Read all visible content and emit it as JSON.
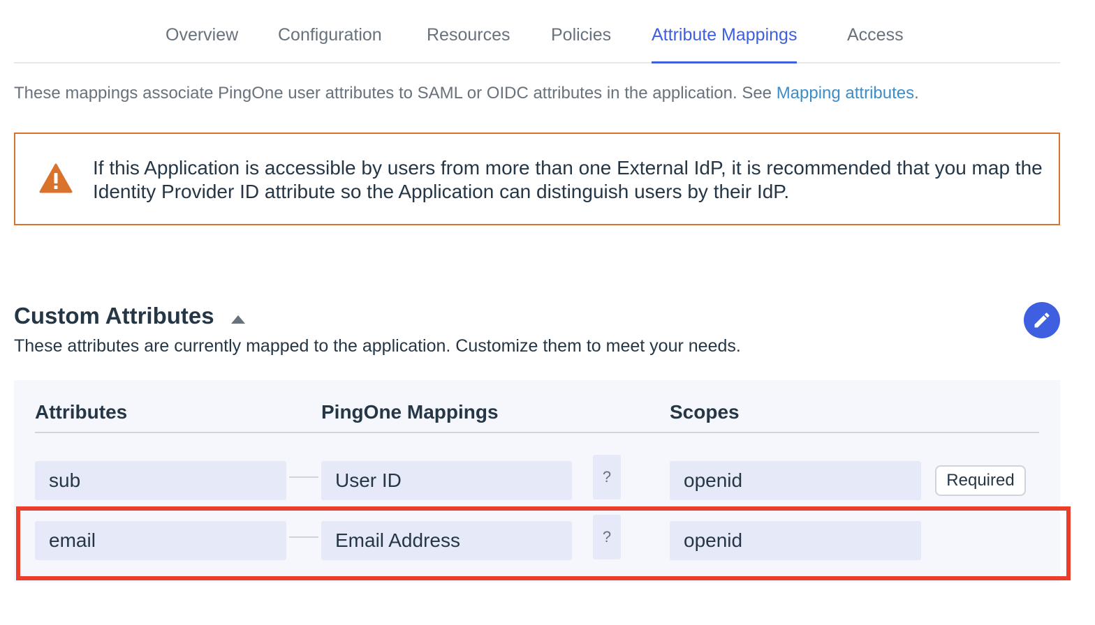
{
  "tabs": [
    {
      "label": "Overview",
      "active": false
    },
    {
      "label": "Configuration",
      "active": false
    },
    {
      "label": "Resources",
      "active": false
    },
    {
      "label": "Policies",
      "active": false
    },
    {
      "label": "Attribute Mappings",
      "active": true
    },
    {
      "label": "Access",
      "active": false
    }
  ],
  "intro": {
    "text": "These mappings associate PingOne user attributes to SAML or OIDC attributes in the application. See ",
    "link": "Mapping attributes",
    "suffix": "."
  },
  "warning": {
    "icon": "warning-triangle-icon",
    "text": "If this Application is accessible by users from more than one External IdP, it is recommended that you map the Identity Provider ID attribute so the Application can distinguish users by their IdP."
  },
  "section": {
    "title": "Custom Attributes",
    "description": "These attributes are currently mapped to the application. Customize them to meet your needs.",
    "edit_icon": "pencil-icon"
  },
  "table": {
    "headers": {
      "attributes": "Attributes",
      "mappings": "PingOne Mappings",
      "scopes": "Scopes"
    },
    "rows": [
      {
        "attribute": "sub",
        "mapping": "User ID",
        "help": "?",
        "scope": "openid",
        "badge": "Required"
      },
      {
        "attribute": "email",
        "mapping": "Email Address",
        "help": "?",
        "scope": "openid",
        "badge": ""
      }
    ]
  },
  "colors": {
    "accent": "#3e5fe0",
    "link": "#3d8dc8",
    "warning": "#d9722b",
    "highlight": "#ea3d2a"
  }
}
